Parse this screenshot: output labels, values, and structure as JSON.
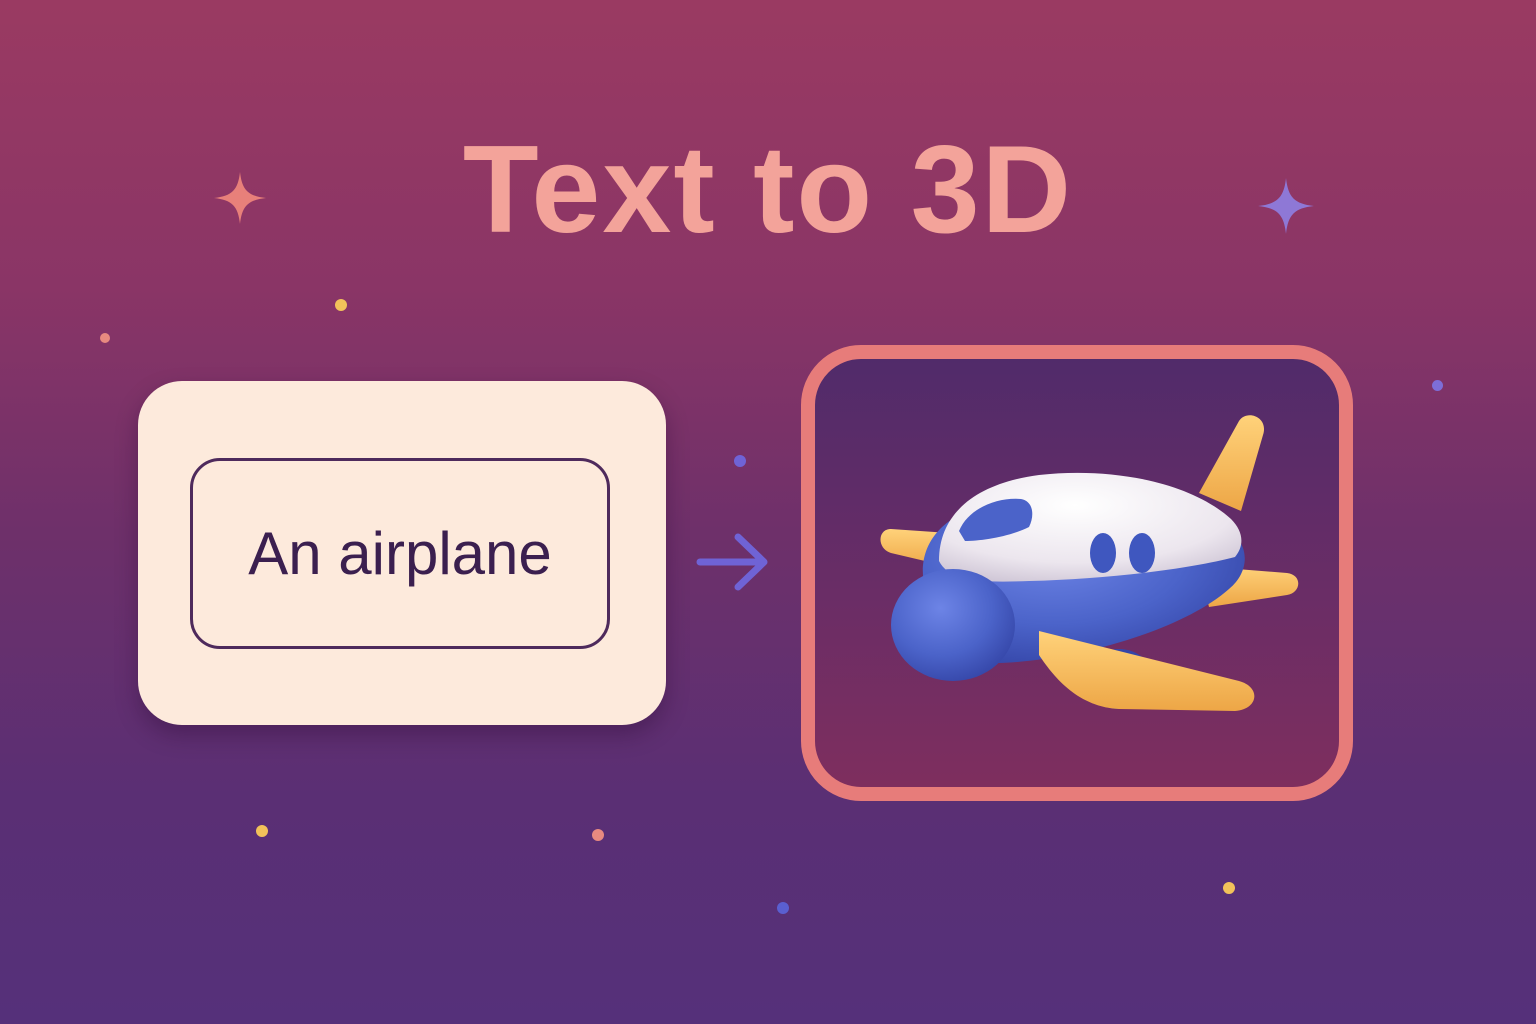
{
  "title": "Text to 3D",
  "input": {
    "value": "An airplane"
  },
  "output": {
    "model_icon": "airplane-3d-icon"
  },
  "colors": {
    "title": "#f3a39a",
    "card_bg": "#fdeadc",
    "field_border": "#4e2a5c",
    "field_text": "#3b1f4f",
    "arrow": "#6f63d6",
    "frame_border": "#e77c7a",
    "plane_body": "#4b63c9",
    "plane_top": "#f2eef3",
    "plane_wing": "#f6b65a"
  },
  "decorations": {
    "sparkle_left_icon": "sparkle-icon",
    "sparkle_right_icon": "sparkle-icon"
  }
}
